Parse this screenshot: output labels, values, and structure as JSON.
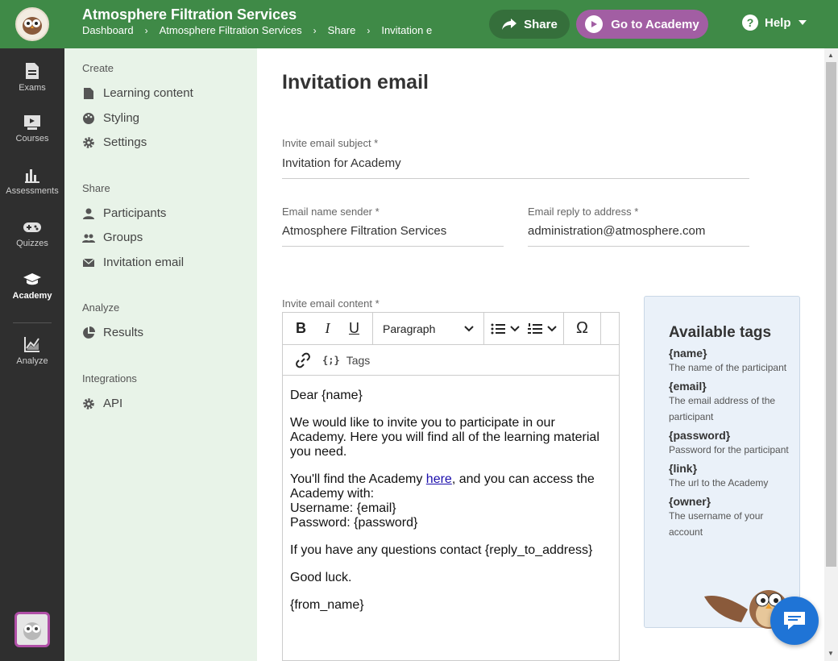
{
  "header": {
    "title": "Atmosphere Filtration Services",
    "breadcrumb": [
      "Dashboard",
      "Atmosphere Filtration Services",
      "Share",
      "Invitation e"
    ],
    "share_label": "Share",
    "academy_label": "Go to Academy",
    "help_label": "Help"
  },
  "rail": {
    "items": [
      {
        "label": "Exams",
        "icon": "document-icon"
      },
      {
        "label": "Courses",
        "icon": "courses-icon"
      },
      {
        "label": "Assessments",
        "icon": "bar-chart-icon"
      },
      {
        "label": "Quizzes",
        "icon": "gamepad-icon"
      },
      {
        "label": "Academy",
        "icon": "graduation-cap-icon",
        "active": true
      },
      {
        "label": "Analyze",
        "icon": "line-chart-icon"
      }
    ]
  },
  "subnav": {
    "sections": [
      {
        "title": "Create",
        "items": [
          "Learning content",
          "Styling",
          "Settings"
        ]
      },
      {
        "title": "Share",
        "items": [
          "Participants",
          "Groups",
          "Invitation email"
        ]
      },
      {
        "title": "Analyze",
        "items": [
          "Results"
        ]
      },
      {
        "title": "Integrations",
        "items": [
          "API"
        ]
      }
    ]
  },
  "main": {
    "title": "Invitation email",
    "subject_label": "Invite email subject *",
    "subject_value": "Invitation for Academy",
    "sender_label": "Email name sender *",
    "sender_value": "Atmosphere Filtration Services",
    "reply_label": "Email reply to address *",
    "reply_value": "administration@atmosphere.com",
    "content_label": "Invite email content *"
  },
  "editor": {
    "paragraph_label": "Paragraph",
    "tags_label": "Tags",
    "tags_braces": "{;}",
    "body": {
      "greeting": "Dear {name}",
      "intro": "We would like to invite you to participate in our Academy. Here you will find all of the learning material you need.",
      "access_before": "You'll find the Academy ",
      "access_link": "here",
      "access_after": ", and you can access the Academy with:",
      "username": "Username: {email}",
      "password": "Password: {password}",
      "questions": "If you have any questions contact {reply_to_address}",
      "good_luck": "Good luck.",
      "sign": "{from_name}"
    }
  },
  "tags_panel": {
    "title": "Available tags",
    "tags": [
      {
        "name": "{name}",
        "desc": "The name of the participant"
      },
      {
        "name": "{email}",
        "desc": "The email address of the participant"
      },
      {
        "name": "{password}",
        "desc": "Password for the participant"
      },
      {
        "name": "{link}",
        "desc": "The url to the Academy"
      },
      {
        "name": "{owner}",
        "desc": "The username of your account"
      }
    ]
  },
  "colors": {
    "header_green": "#3f8a47",
    "share_button": "#356f3b",
    "academy_button": "#a25ea3",
    "rail_bg": "#2f2f2f",
    "subnav_bg": "#e8f3e8",
    "tags_bg": "#eaf1f9",
    "chat_blue": "#1f74d6"
  }
}
